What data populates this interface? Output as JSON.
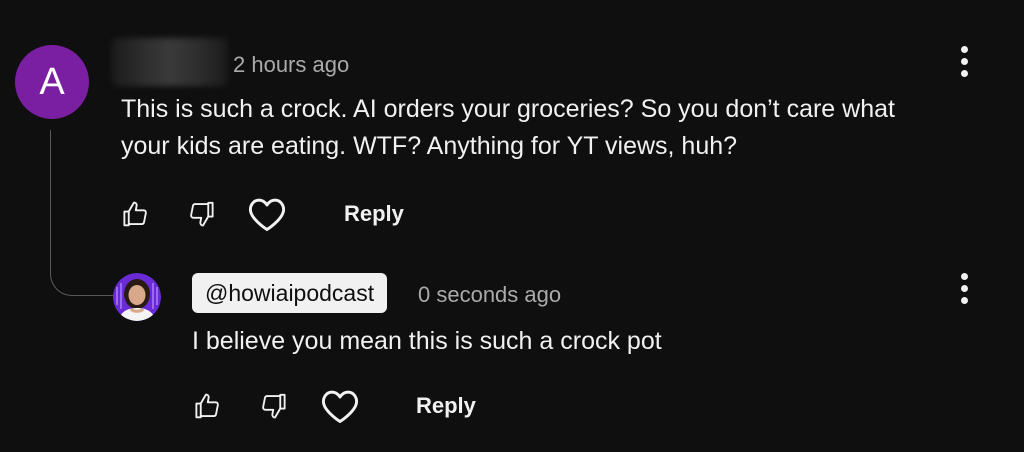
{
  "comment": {
    "avatar_letter": "A",
    "timestamp": "2 hours ago",
    "text_line1": "This is such a crock. AI orders your groceries? So you don’t care what",
    "text_line2": "your kids are eating. WTF? Anything for YT views, huh?",
    "reply_label": "Reply",
    "avatar_color": "#7b1fa2"
  },
  "reply": {
    "handle": "@howiaipodcast",
    "timestamp": "0 seconds ago",
    "text": "I believe you mean this is such a crock pot",
    "reply_label": "Reply",
    "avatar_ring_color": "#6a2bd6"
  },
  "icons": {
    "like": "thumbs-up-icon",
    "dislike": "thumbs-down-icon",
    "heart": "heart-icon",
    "more": "more-vert-icon"
  }
}
